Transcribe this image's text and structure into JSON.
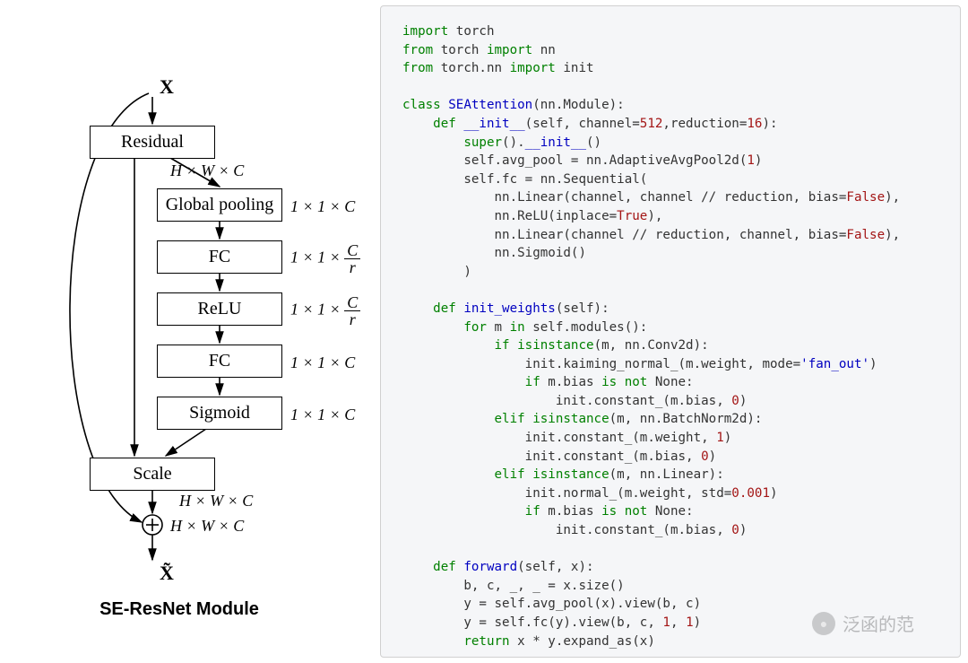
{
  "diagram": {
    "input_symbol": "X",
    "output_symbol": "X̃",
    "caption": "SE-ResNet Module",
    "nodes": {
      "residual": "Residual",
      "global_pool": "Global pooling",
      "fc1": "FC",
      "relu": "ReLU",
      "fc2": "FC",
      "sigmoid": "Sigmoid",
      "scale": "Scale"
    },
    "dims": {
      "residual": "H × W × C",
      "global_pool": "1 × 1 × C",
      "fc1_frac_num": "C",
      "fc1_frac_den": "r",
      "fc1_prefix": "1 × 1 × ",
      "relu_frac_num": "C",
      "relu_frac_den": "r",
      "relu_prefix": "1 × 1 × ",
      "fc2": "1 × 1 × C",
      "sigmoid": "1 × 1 × C",
      "scale": "H × W × C",
      "plus": "H × W × C"
    }
  },
  "code": {
    "l01a": "import",
    "l01b": " torch",
    "l02a": "from",
    "l02b": " torch ",
    "l02c": "import",
    "l02d": " nn",
    "l03a": "from",
    "l03b": " torch.nn ",
    "l03c": "import",
    "l03d": " init",
    "l05a": "class",
    "l05b": " SEAttention",
    "l05c": "(nn.Module):",
    "l06a": "    def",
    "l06b": " __init__",
    "l06c": "(self, channel=",
    "l06d": "512",
    "l06e": ",reduction=",
    "l06f": "16",
    "l06g": "):",
    "l07a": "        super",
    "l07b": "().",
    "l07c": "__init__",
    "l07d": "()",
    "l08a": "        self.avg_pool = nn.AdaptiveAvgPool2d(",
    "l08b": "1",
    "l08c": ")",
    "l09a": "        self.fc = nn.Sequential(",
    "l10a": "            nn.Linear(channel, channel // reduction, bias=",
    "l10b": "False",
    "l10c": "),",
    "l11a": "            nn.ReLU(inplace=",
    "l11b": "True",
    "l11c": "),",
    "l12a": "            nn.Linear(channel // reduction, channel, bias=",
    "l12b": "False",
    "l12c": "),",
    "l13a": "            nn.Sigmoid()",
    "l14a": "        )",
    "l16a": "    def",
    "l16b": " init_weights",
    "l16c": "(self):",
    "l17a": "        for",
    "l17b": " m ",
    "l17c": "in",
    "l17d": " self.modules():",
    "l18a": "            if",
    "l18b": " isinstance",
    "l18c": "(m, nn.Conv2d):",
    "l19a": "                init.kaiming_normal_(m.weight, mode=",
    "l19b": "'fan_out'",
    "l19c": ")",
    "l20a": "                if",
    "l20b": " m.bias ",
    "l20c": "is not",
    "l20d": " None:",
    "l21a": "                    init.constant_(m.bias, ",
    "l21b": "0",
    "l21c": ")",
    "l22a": "            elif",
    "l22b": " isinstance",
    "l22c": "(m, nn.BatchNorm2d):",
    "l23a": "                init.constant_(m.weight, ",
    "l23b": "1",
    "l23c": ")",
    "l24a": "                init.constant_(m.bias, ",
    "l24b": "0",
    "l24c": ")",
    "l25a": "            elif",
    "l25b": " isinstance",
    "l25c": "(m, nn.Linear):",
    "l26a": "                init.normal_(m.weight, std=",
    "l26b": "0.001",
    "l26c": ")",
    "l27a": "                if",
    "l27b": " m.bias ",
    "l27c": "is not",
    "l27d": " None:",
    "l28a": "                    init.constant_(m.bias, ",
    "l28b": "0",
    "l28c": ")",
    "l30a": "    def",
    "l30b": " forward",
    "l30c": "(self, x):",
    "l31a": "        b, c, _, _ = x.size()",
    "l32a": "        y = self.avg_pool(x).view(b, c)",
    "l33a": "        y = self.fc(y).view(b, c, ",
    "l33b": "1",
    "l33c": ", ",
    "l33d": "1",
    "l33e": ")",
    "l34a": "        return",
    "l34b": " x * y.expand_as(x)"
  },
  "watermark": "泛函的范"
}
